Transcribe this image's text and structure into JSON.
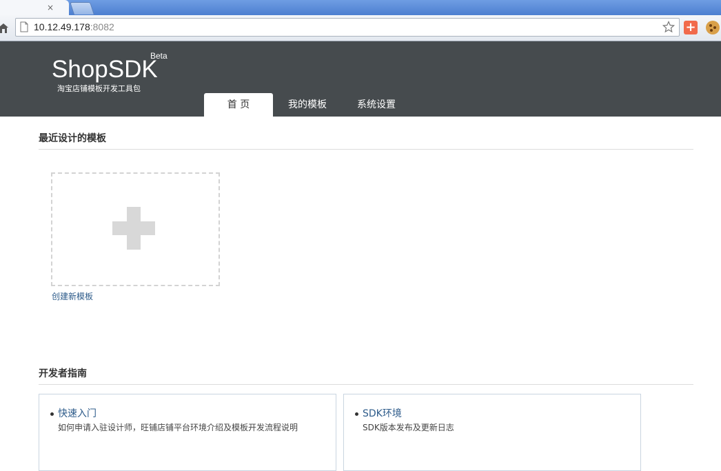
{
  "browser": {
    "tab_close_glyph": "×",
    "url_host": "10.12.49.178",
    "url_port": ":8082",
    "extension_plus_glyph": "+"
  },
  "header": {
    "logo": "ShopSDK",
    "beta": "Beta",
    "tagline": "淘宝店铺模板开发工具包",
    "nav": [
      {
        "label": "首 页"
      },
      {
        "label": "我的模板"
      },
      {
        "label": "系统设置"
      }
    ]
  },
  "recent": {
    "title": "最近设计的模板",
    "create_label": "创建新模板"
  },
  "guide": {
    "title": "开发者指南",
    "cards": [
      {
        "link": "快速入门",
        "desc": "如何申请入驻设计师，旺铺店铺平台环境介绍及模板开发流程说明"
      },
      {
        "link": "SDK环境",
        "desc": "SDK版本发布及更新日志"
      }
    ]
  },
  "colors": {
    "header_bg": "#464b4e",
    "link": "#2d5b8a"
  }
}
